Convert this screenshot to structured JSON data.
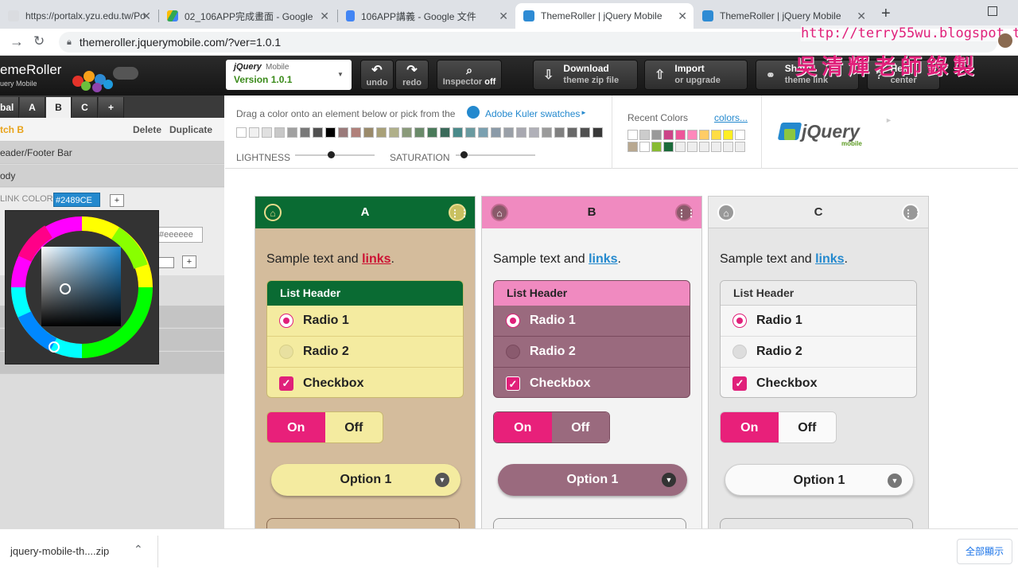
{
  "browser": {
    "tabs": [
      {
        "title": "https://portalx.yzu.edu.tw/Po",
        "icon": "page-icon",
        "color": "#dadce0"
      },
      {
        "title": "02_106APP完成畫面 - Google",
        "icon": "google-drive-icon",
        "color": "#34a853"
      },
      {
        "title": "106APP講義 - Google 文件",
        "icon": "google-docs-icon",
        "color": "#4285f4"
      },
      {
        "title": "ThemeRoller | jQuery Mobile",
        "icon": "themeroller-icon",
        "color": "#2e8bd4"
      },
      {
        "title": "ThemeRoller | jQuery Mobile",
        "icon": "themeroller-icon",
        "color": "#2e8bd4"
      }
    ],
    "url": "themeroller.jquerymobile.com/?ver=1.0.1"
  },
  "app": {
    "logo_title": "emeRoller",
    "logo_sub": "uery Mobile",
    "version_brand": "jQuery",
    "version_brand_sub": "Mobile",
    "version_label": "Version 1.0.1",
    "undo": "undo",
    "redo": "redo",
    "inspector": "Inspector",
    "inspector_state": "off",
    "download_title": "Download",
    "download_sub": "theme zip file",
    "import_title": "Import",
    "import_sub": "or upgrade",
    "share_title": "Share",
    "share_sub": "theme link",
    "help_title": "Help",
    "help_sub": "center"
  },
  "left": {
    "tabs": [
      "bal",
      "A",
      "B",
      "C",
      "+"
    ],
    "active_tab": "B",
    "swatch_title": "tch B",
    "delete": "Delete",
    "duplicate": "Duplicate",
    "section_header": "eader/Footer Bar",
    "section_body": "ody",
    "link_color_label": "LINK COLOR",
    "link_color_value": "#2489CE",
    "second_color_value": "#eeeeee"
  },
  "swatches": {
    "drag_text": "Drag a color onto an element below or pick from the",
    "kuler_label": "Adobe Kuler swatches",
    "kuler_arrow": "►",
    "lightness_label": "LIGHTNESS",
    "saturation_label": "SATURATION",
    "lightness_level": 0.45,
    "saturation_level": 0.1,
    "recent_label": "Recent Colors",
    "colors_link": "colors...",
    "jquery_logo": "jQuery",
    "jquery_logo_sub": "mobile",
    "palette": [
      "#ffffff",
      "#f0f0f0",
      "#e0e0e0",
      "#c8c8c8",
      "#a0a0a0",
      "#787878",
      "#505050",
      "#000000",
      "#9a7a7a",
      "#b0807a",
      "#9a8a6a",
      "#a8a078",
      "#b0b08a",
      "#8a9a7a",
      "#6a8a6a",
      "#4a7a5a",
      "#3a6a5a",
      "#4a8a8a",
      "#6a9aa0",
      "#7aa0b0",
      "#8a9aa8",
      "#9aa0a8",
      "#a8a8b0",
      "#b0b0b8",
      "#9a9a9a",
      "#808080",
      "#686868",
      "#505050",
      "#383838"
    ],
    "recent": [
      "#ffffff",
      "#cccccc",
      "#999999",
      "#cc4488",
      "#ee5599",
      "#ff88bb",
      "#ffcc66",
      "#ffdd44",
      "#ffee22",
      "#ffffff",
      "#b8a890",
      "#ffffff",
      "#88bb33",
      "#1a6a3a",
      "#eeeeee",
      "#eeeeee",
      "#eeeeee",
      "#eeeeee",
      "#eeeeee",
      "#eeeeee"
    ]
  },
  "columns": [
    {
      "letter": "A",
      "head_bg": "#0a6b33",
      "body_bg": "#d4bc9c",
      "sample_text": "Sample text and ",
      "link_text": "links",
      "link_color": "#cc1133",
      "list_header": "List Header",
      "items": [
        "Radio 1",
        "Radio 2",
        "Checkbox"
      ],
      "on": "On",
      "off": "Off",
      "option": "Option 1"
    },
    {
      "letter": "B",
      "head_bg": "#f08ac0",
      "body_bg": "#f3f3f3",
      "sample_text": "Sample text and ",
      "link_text": "links",
      "link_color": "#2489ce",
      "list_header": "List Header",
      "items": [
        "Radio 1",
        "Radio 2",
        "Checkbox"
      ],
      "on": "On",
      "off": "Off",
      "option": "Option 1"
    },
    {
      "letter": "C",
      "head_bg": "#ececec",
      "body_bg": "#e6e6e6",
      "sample_text": "Sample text and ",
      "link_text": "links",
      "link_color": "#2489ce",
      "list_header": "List Header",
      "items": [
        "Radio 1",
        "Radio 2",
        "Checkbox"
      ],
      "on": "On",
      "off": "Off",
      "option": "Option 1"
    }
  ],
  "download_bar": {
    "filename": "jquery-mobile-th....zip",
    "show_all": "全部顯示"
  },
  "watermark": {
    "url": "http://terry55wu.blogspot.tw",
    "text": "吳清輝老師錄製"
  }
}
